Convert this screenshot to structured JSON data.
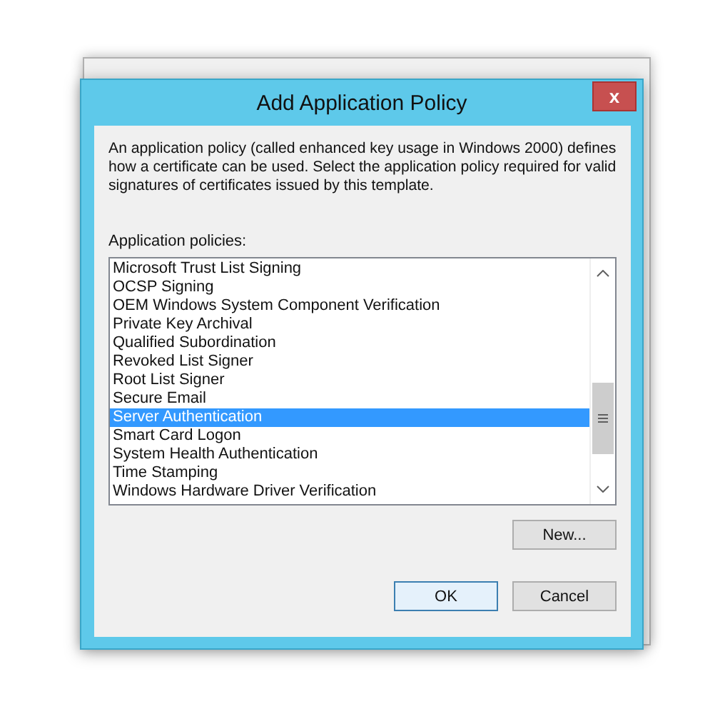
{
  "dialog": {
    "title": "Add Application Policy",
    "close": "x",
    "description": "An application policy (called enhanced key usage in Windows 2000) defines how a certificate can be used. Select the application policy required for valid signatures of certificates issued by this template.",
    "list_label": "Application policies:",
    "policies": [
      {
        "label": "Microsoft Trust List Signing",
        "selected": false
      },
      {
        "label": "OCSP Signing",
        "selected": false
      },
      {
        "label": "OEM Windows System Component Verification",
        "selected": false
      },
      {
        "label": "Private Key Archival",
        "selected": false
      },
      {
        "label": "Qualified Subordination",
        "selected": false
      },
      {
        "label": "Revoked List Signer",
        "selected": false
      },
      {
        "label": "Root List Signer",
        "selected": false
      },
      {
        "label": "Secure Email",
        "selected": false
      },
      {
        "label": "Server Authentication",
        "selected": true
      },
      {
        "label": "Smart Card Logon",
        "selected": false
      },
      {
        "label": "System Health Authentication",
        "selected": false
      },
      {
        "label": "Time Stamping",
        "selected": false
      },
      {
        "label": "Windows Hardware Driver Verification",
        "selected": false
      }
    ],
    "buttons": {
      "new": "New...",
      "ok": "OK",
      "cancel": "Cancel"
    }
  }
}
